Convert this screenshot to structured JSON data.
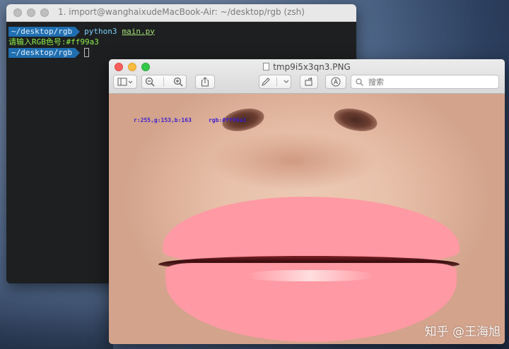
{
  "terminal": {
    "title": "1. import@wanghaixudeMacBook-Air: ~/desktop/rgb (zsh)",
    "prompt_path": "~/desktop/rgb",
    "command": "python3",
    "command_arg": "main.py",
    "output": "请输入RGB色号:#ff99a3",
    "prompt_path_2": "~/desktop/rgb"
  },
  "preview": {
    "title": "tmp9i5x3qn3.PNG",
    "search_placeholder": "搜索",
    "image_label_rgb": "r:255,g:153,b:163",
    "image_label_hex": "rgb:#ff99a3",
    "lip_color": "#ff99a3"
  },
  "watermark": "知乎 @王海旭"
}
